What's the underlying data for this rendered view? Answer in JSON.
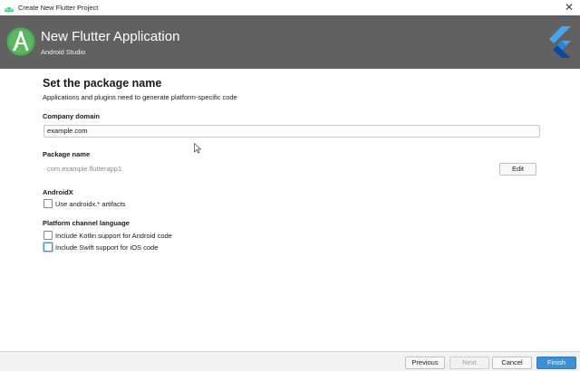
{
  "window": {
    "title": "Create New Flutter Project",
    "close_glyph": "✕"
  },
  "header": {
    "title": "New Flutter Application",
    "subtitle": "Android Studio",
    "logo_icon": "android-studio-icon",
    "brand_icon": "flutter-logo-icon",
    "background": "#616161"
  },
  "main": {
    "heading": "Set the package name",
    "description": "Applications and plugins need to generate platform-specific code",
    "company_domain": {
      "label": "Company domain",
      "value": "example.com"
    },
    "package_name": {
      "label": "Package name",
      "value": "com.example.flutterapp1",
      "edit_label": "Edit"
    },
    "androidx": {
      "label": "AndroidX",
      "option": "Use androidx.* artifacts",
      "checked": false
    },
    "platform_channel": {
      "label": "Platform channel language",
      "kotlin_option": "Include Kotlin support for Android code",
      "kotlin_checked": false,
      "swift_option": "Include Swift support for iOS code",
      "swift_checked": false
    }
  },
  "footer": {
    "previous_label": "Previous",
    "next_label": "Next",
    "cancel_label": "Cancel",
    "finish_label": "Finish",
    "accent": "#3d8fd6"
  }
}
